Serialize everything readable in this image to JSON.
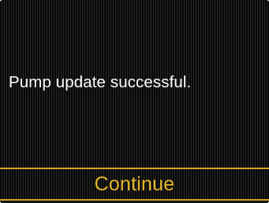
{
  "screen": {
    "message": "Pump update successful."
  },
  "action": {
    "label": "Continue"
  },
  "colors": {
    "background": "#0f0f0f",
    "text": "#ffffff",
    "accent": "#e4b62b",
    "divider": "#d2a429"
  }
}
